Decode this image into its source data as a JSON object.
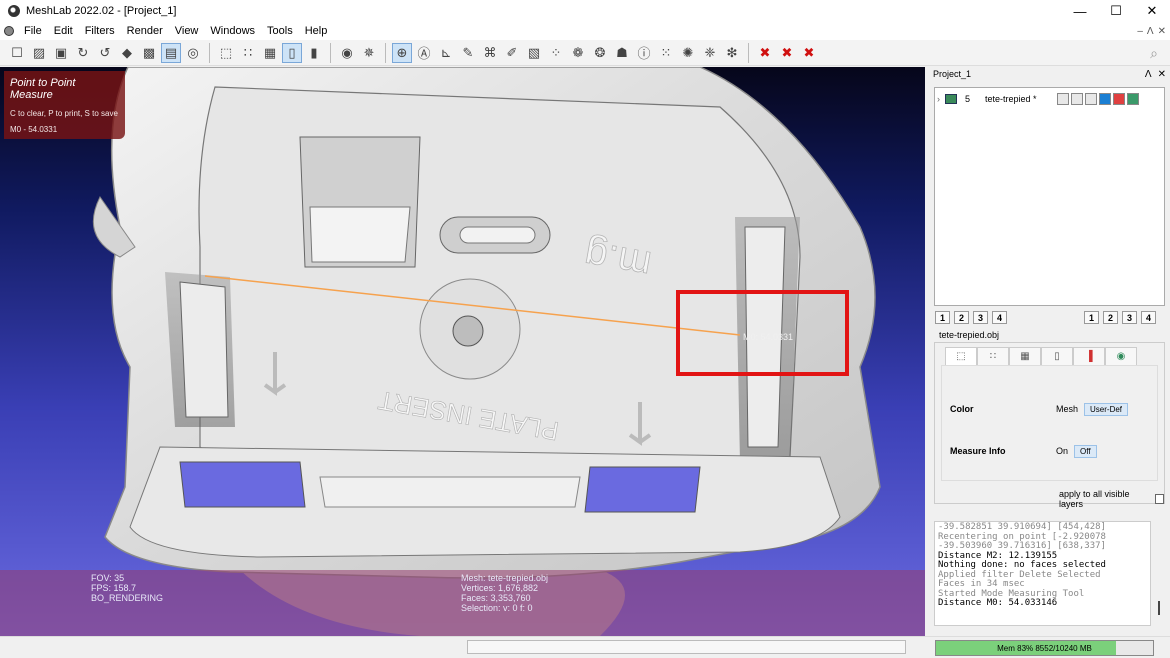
{
  "window": {
    "title": "MeshLab 2022.02 - [Project_1]",
    "controls": [
      "—",
      "☐",
      "✕"
    ]
  },
  "menu": {
    "items": [
      "File",
      "Edit",
      "Filters",
      "Render",
      "View",
      "Windows",
      "Tools",
      "Help"
    ],
    "mdi": [
      "–",
      "Ʌ",
      "✕"
    ]
  },
  "toolbar": {
    "groups": [
      [
        {
          "name": "new-project-icon",
          "glyph": "☐"
        },
        {
          "name": "open-project-icon",
          "glyph": "▨"
        },
        {
          "name": "import-mesh-icon",
          "glyph": "▣"
        },
        {
          "name": "reload-icon",
          "glyph": "↻"
        },
        {
          "name": "reload-all-icon",
          "glyph": "↺"
        },
        {
          "name": "export-mesh-icon",
          "glyph": "◆"
        },
        {
          "name": "snapshot-icon",
          "glyph": "▩"
        },
        {
          "name": "layers-icon",
          "glyph": "▤",
          "active": true
        },
        {
          "name": "raster-icon",
          "glyph": "◎"
        }
      ],
      [
        {
          "name": "bbox-icon",
          "glyph": "⬚"
        },
        {
          "name": "points-icon",
          "glyph": "∷"
        },
        {
          "name": "wireframe-icon",
          "glyph": "▦"
        },
        {
          "name": "flat-shading-icon",
          "glyph": "▯",
          "active": true
        },
        {
          "name": "smooth-shading-icon",
          "glyph": "▮"
        }
      ],
      [
        {
          "name": "color-icon",
          "glyph": "◉"
        },
        {
          "name": "normals-icon",
          "glyph": "✵"
        }
      ],
      [
        {
          "name": "trackball-icon",
          "glyph": "⊕",
          "active": true
        },
        {
          "name": "annotation-icon",
          "glyph": "Ⓐ"
        },
        {
          "name": "measure-icon",
          "glyph": "⊾"
        },
        {
          "name": "paint-icon",
          "glyph": "✎"
        },
        {
          "name": "select-faces-icon",
          "glyph": "⌘"
        },
        {
          "name": "brush-icon",
          "glyph": "✐"
        },
        {
          "name": "texture-icon",
          "glyph": "▧"
        },
        {
          "name": "select-vertices-icon",
          "glyph": "⁘"
        },
        {
          "name": "align-icon",
          "glyph": "❁"
        },
        {
          "name": "manipulator-icon",
          "glyph": "❂"
        },
        {
          "name": "quality-icon",
          "glyph": "☗"
        },
        {
          "name": "info-icon",
          "glyph": "ⓘ"
        },
        {
          "name": "select-connected-icon",
          "glyph": "⁙"
        },
        {
          "name": "pickpoints-icon",
          "glyph": "✺"
        },
        {
          "name": "reference-icon",
          "glyph": "❈"
        },
        {
          "name": "lasso-icon",
          "glyph": "❇"
        }
      ],
      [
        {
          "name": "delete-selected-icon",
          "glyph": "✖",
          "red": true
        },
        {
          "name": "delete-vertices-icon",
          "glyph": "✖",
          "red": true
        },
        {
          "name": "delete-faces-icon",
          "glyph": "✖",
          "red": true
        }
      ]
    ]
  },
  "hud": {
    "title": "Point to Point Measure",
    "help": "C to clear, P to print, S to save",
    "measurement": "M0 - 54.0331"
  },
  "measure_label": "M0: 54.0331",
  "info": {
    "fov": "FOV: 35",
    "fps": "FPS:   158.7",
    "render_mode": "BO_RENDERING",
    "mesh": "Mesh: tete-trepied.obj",
    "vertices": "Vertices: 1,676,882",
    "faces": "Faces: 3,353,760",
    "selection": "Selection: v: 0 f: 0"
  },
  "panel": {
    "title": "Project_1",
    "head_icons": [
      "Ʌ",
      "✕"
    ],
    "layer": {
      "index": "5",
      "name": "tete-trepied *"
    },
    "left_tabs": [
      "1",
      "2",
      "3",
      "4"
    ],
    "right_tabs": [
      "1",
      "2",
      "3",
      "4"
    ],
    "file": "tete-trepied.obj",
    "prop_tabs": [
      "⬚",
      "∷",
      "▦",
      "▯",
      "▐",
      "◉"
    ],
    "color": {
      "label": "Color",
      "option": "Mesh",
      "value": "User-Def"
    },
    "measure": {
      "label": "Measure Info",
      "on": "On",
      "off": "Off"
    },
    "apply_all": "apply to all visible layers"
  },
  "log": [
    {
      "text": "-39.582851 39.910694] [454,428]",
      "dim": true
    },
    {
      "text": "Recentering on point [-2.920078",
      "dim": true
    },
    {
      "text": "-39.503960 39.716316] [638,337]",
      "dim": true
    },
    {
      "text": "Distance M2: 12.139155",
      "dim": false
    },
    {
      "text": "Nothing done: no faces selected",
      "dim": false
    },
    {
      "text": "Applied filter Delete Selected",
      "dim": true
    },
    {
      "text": "Faces in 34 msec",
      "dim": true
    },
    {
      "text": "Started Mode Measuring Tool",
      "dim": true
    },
    {
      "text": "Distance M0: 54.033146",
      "dim": false
    }
  ],
  "memory": {
    "text": "Mem 83% 8552/10240 MB",
    "fraction": 0.83
  }
}
